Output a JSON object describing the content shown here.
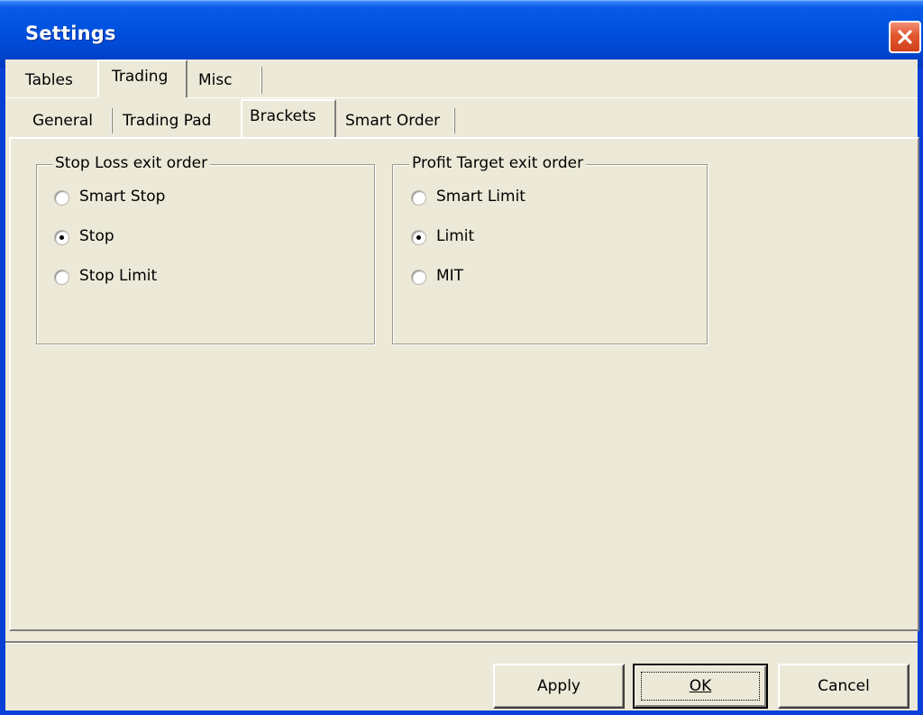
{
  "window": {
    "title": "Settings"
  },
  "outer_tabs": [
    {
      "label": "Tables",
      "selected": false
    },
    {
      "label": "Trading",
      "selected": true
    },
    {
      "label": "Misc",
      "selected": false
    }
  ],
  "inner_tabs": [
    {
      "label": "General",
      "selected": false
    },
    {
      "label": "Trading Pad",
      "selected": false
    },
    {
      "label": "Brackets",
      "selected": true
    },
    {
      "label": "Smart Order",
      "selected": false
    }
  ],
  "stop_loss": {
    "title": "Stop Loss exit order",
    "options": [
      {
        "label": "Smart Stop",
        "checked": false
      },
      {
        "label": "Stop",
        "checked": true
      },
      {
        "label": "Stop Limit",
        "checked": false
      }
    ]
  },
  "profit_target": {
    "title": "Profit Target exit order",
    "options": [
      {
        "label": "Smart Limit",
        "checked": false
      },
      {
        "label": "Limit",
        "checked": true
      },
      {
        "label": "MIT",
        "checked": false
      }
    ]
  },
  "buttons": {
    "apply": "Apply",
    "ok": "OK",
    "cancel": "Cancel"
  },
  "colors": {
    "titlebar": "#0052e0",
    "dialog_face": "#ece9d8",
    "close_button": "#e2572f"
  },
  "icons": {
    "close": "close-icon"
  }
}
